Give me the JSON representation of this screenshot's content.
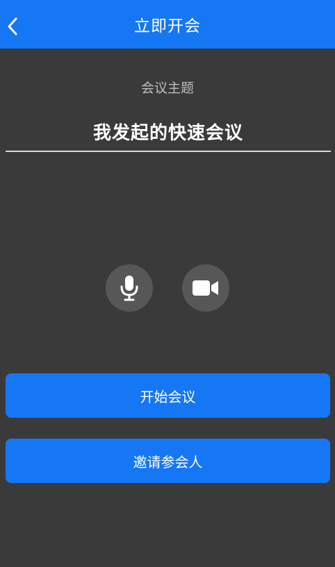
{
  "header": {
    "title": "立即开会",
    "back_icon": "chevron-left-icon"
  },
  "meeting": {
    "topic_label": "会议主题",
    "topic_value": "我发起的快速会议"
  },
  "controls": {
    "mic_icon": "microphone-icon",
    "camera_icon": "video-camera-icon"
  },
  "actions": {
    "start_label": "开始会议",
    "invite_label": "邀请参会人"
  },
  "colors": {
    "accent": "#1677f5",
    "background": "#3a3a3a",
    "control_bg": "#575757"
  }
}
